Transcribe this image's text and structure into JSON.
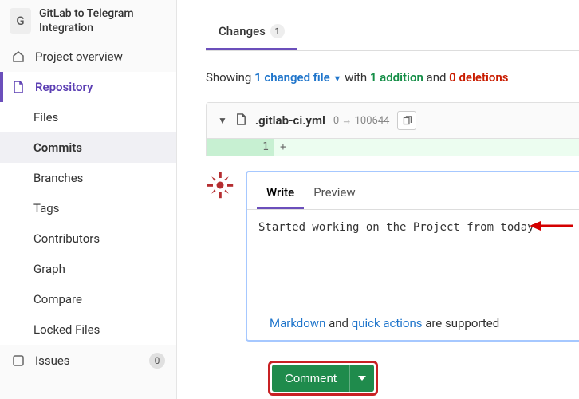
{
  "project": {
    "avatar_letter": "G",
    "name": "GitLab to Telegram Integration"
  },
  "sidebar": {
    "overview": "Project overview",
    "repository": "Repository",
    "items": [
      "Files",
      "Commits",
      "Branches",
      "Tags",
      "Contributors",
      "Graph",
      "Compare",
      "Locked Files"
    ],
    "issues": "Issues",
    "issues_count": "0"
  },
  "tabs": {
    "changes": "Changes",
    "changes_count": "1"
  },
  "showing": {
    "prefix": "Showing ",
    "files": "1 changed file",
    "with": " with ",
    "additions": "1 addition",
    "and": " and ",
    "deletions": "0 deletions"
  },
  "file": {
    "name": ".gitlab-ci.yml",
    "mode": "0 → 100644",
    "line_new": "1",
    "plus": "+"
  },
  "editor": {
    "tabs": {
      "write": "Write",
      "preview": "Preview"
    },
    "text": "Started working on the Project from today",
    "hint_markdown": "Markdown",
    "hint_and": " and ",
    "hint_quick": "quick actions",
    "hint_supported": " are supported"
  },
  "buttons": {
    "comment": "Comment"
  }
}
